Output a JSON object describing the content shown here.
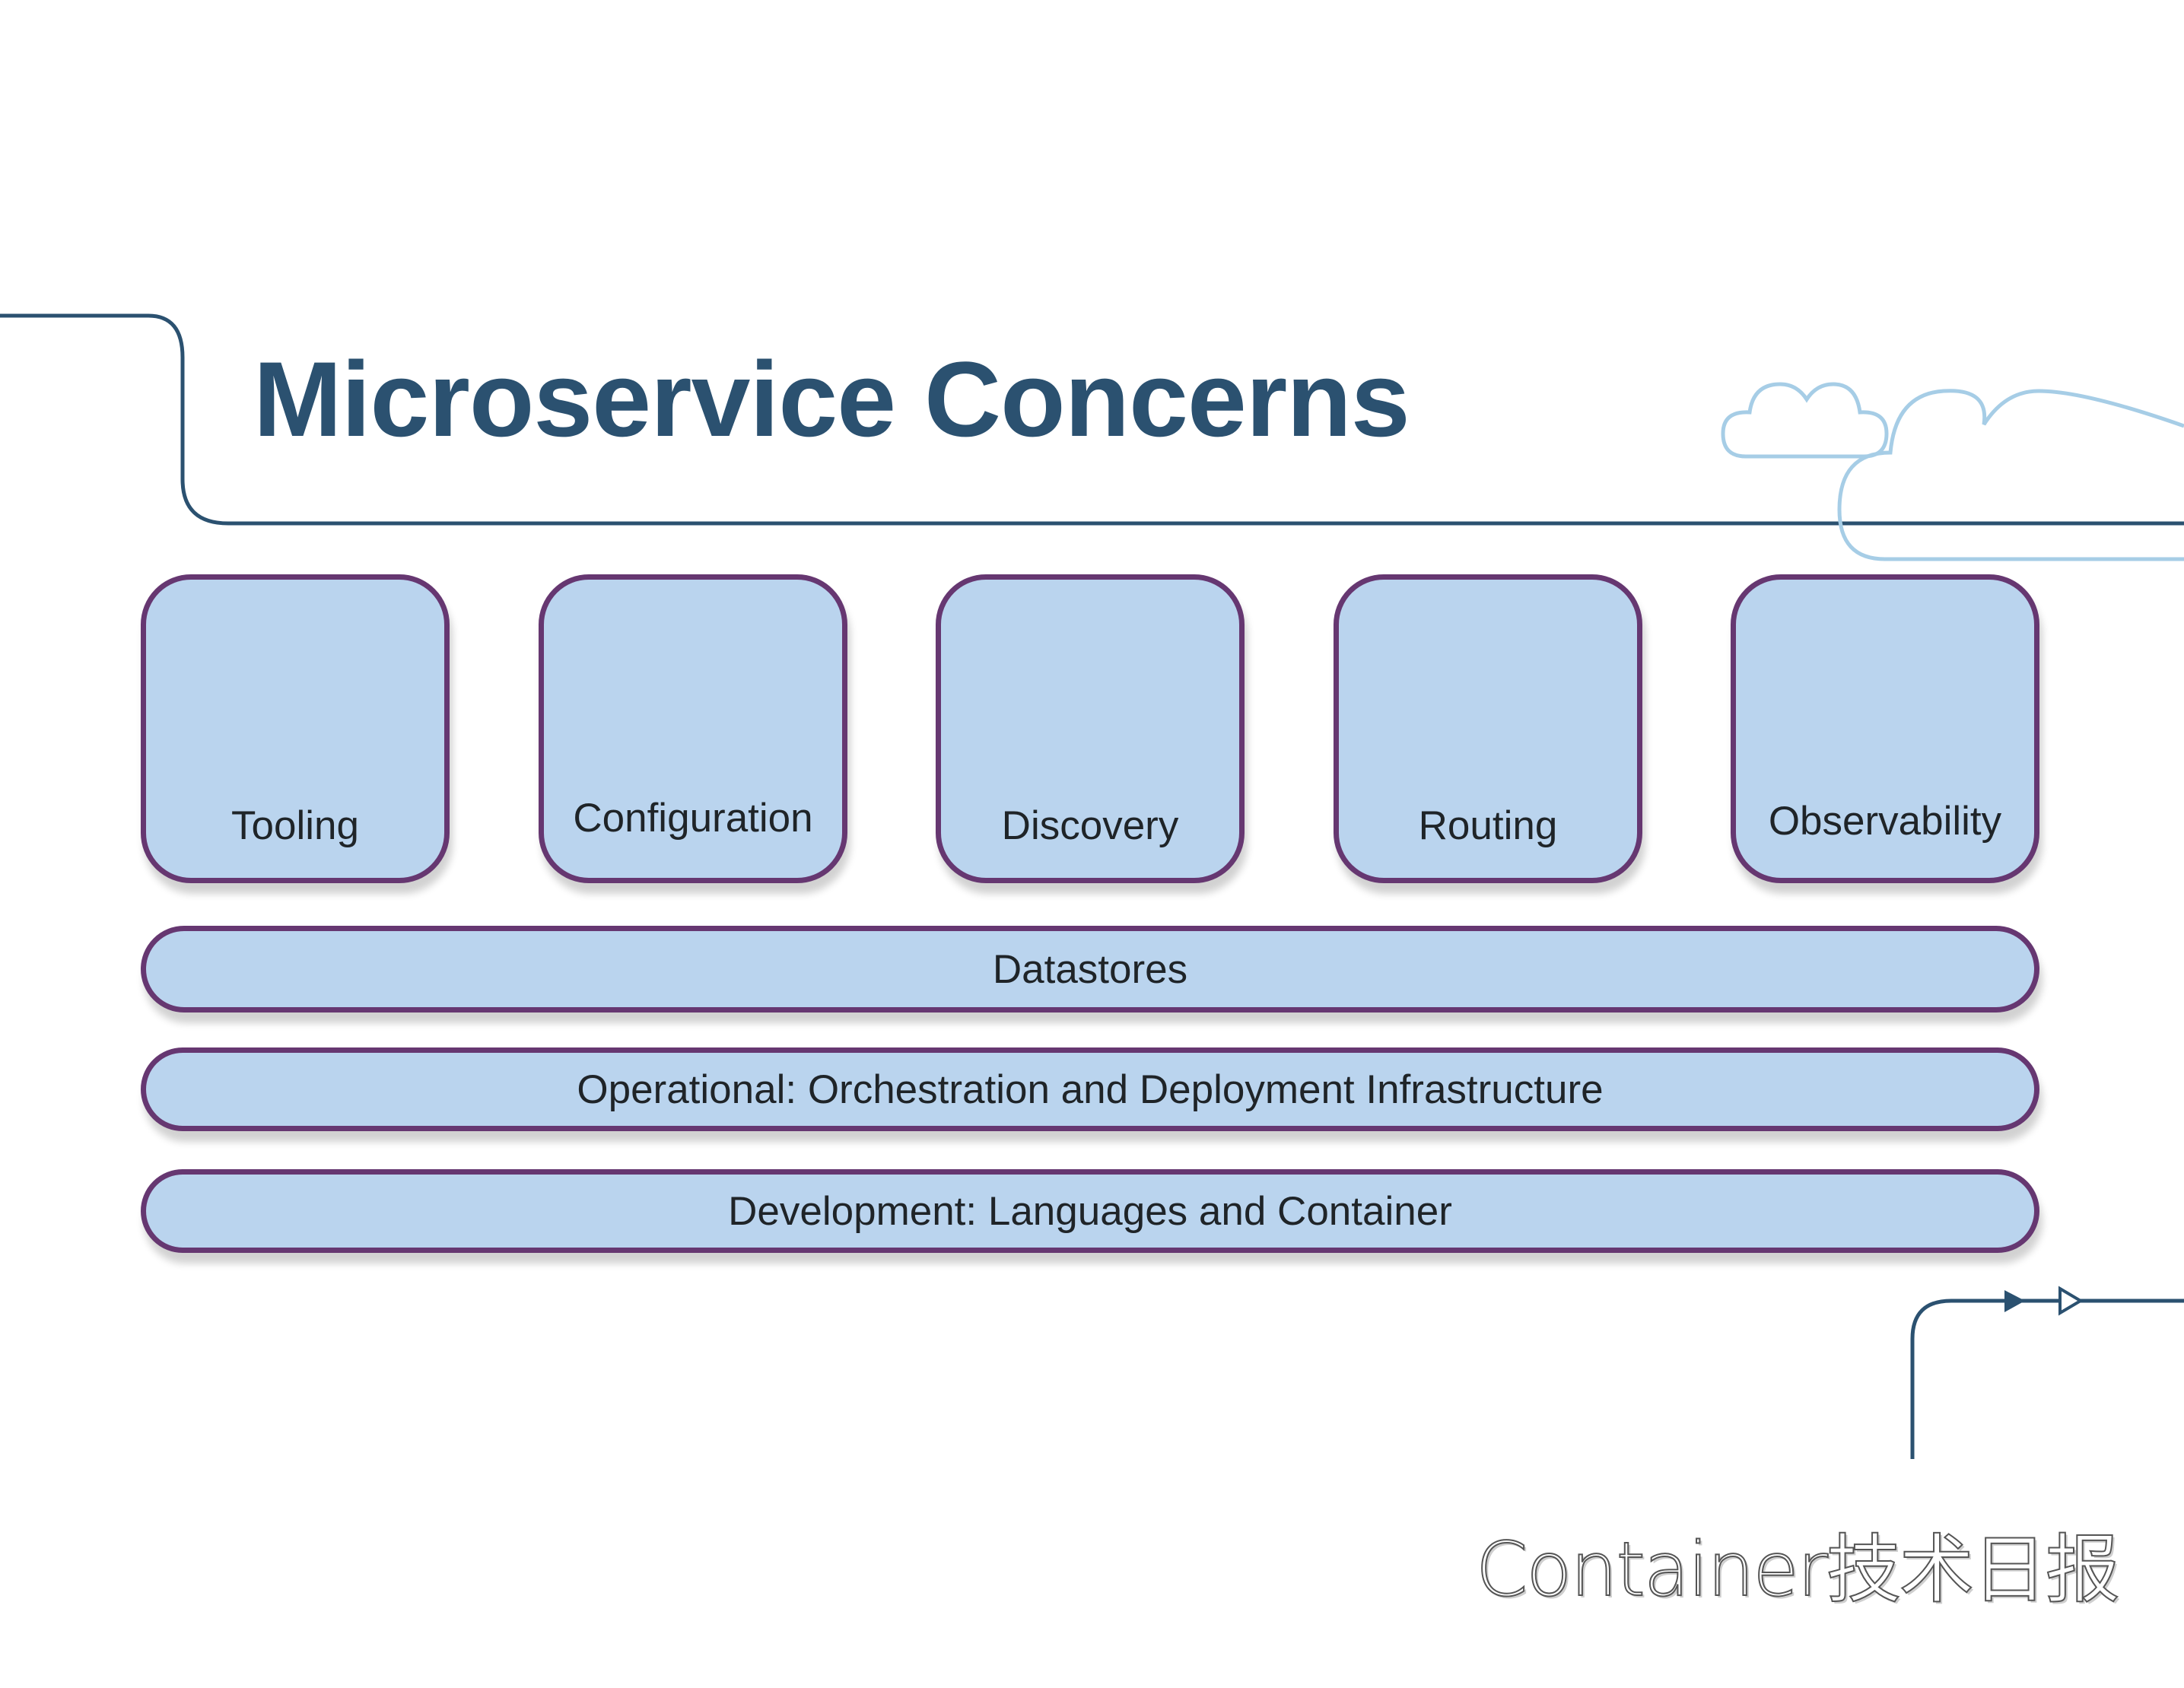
{
  "slide": {
    "title": "Microservice Concerns",
    "colors": {
      "title": "#2b5170",
      "accent_line": "#2b5170",
      "box_fill": "#bad4ee",
      "box_border": "#663771",
      "cloud_outline": "#a6cde6",
      "text": "#1f2428"
    }
  },
  "concerns": [
    {
      "label": "Tooling"
    },
    {
      "label": "Configuration"
    },
    {
      "label": "Discovery"
    },
    {
      "label": "Routing"
    },
    {
      "label": "Observability"
    }
  ],
  "layers": [
    {
      "label": "Datastores"
    },
    {
      "label": "Operational: Orchestration and Deployment Infrastructure"
    },
    {
      "label": "Development: Languages and Container"
    }
  ],
  "decorations": {
    "icons": [
      "cloud-icon",
      "cloud-icon",
      "arrow-filled-icon",
      "arrow-hollow-icon"
    ]
  },
  "watermark": "Container技术日报"
}
